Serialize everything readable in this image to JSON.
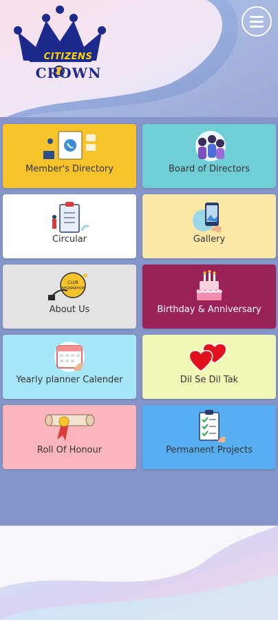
{
  "brand": {
    "line1": "CITIZENS",
    "line2": "CROWN"
  },
  "menu": {
    "icon": "hamburger-menu-icon"
  },
  "tiles": [
    {
      "label": "Member's Directory",
      "color": "#f6c32b",
      "icon": "directory-icon"
    },
    {
      "label": "Board of Directors",
      "color": "#70cfd6",
      "icon": "people-group-icon"
    },
    {
      "label": "Circular",
      "color": "#ffffff",
      "icon": "clipboard-icon"
    },
    {
      "label": "Gallery",
      "color": "#fbe7a6",
      "icon": "photo-phone-icon"
    },
    {
      "label": "About Us",
      "color": "#e3e3e3",
      "icon": "info-tag-icon"
    },
    {
      "label": "Birthday & Anniversary",
      "color": "#9b2159",
      "icon": "cake-icon"
    },
    {
      "label": "Yearly planner Calender",
      "color": "#a6e6f7",
      "icon": "calendar-icon"
    },
    {
      "label": "Dil Se Dil Tak",
      "color": "#f2f7b5",
      "icon": "hearts-icon"
    },
    {
      "label": "Roll Of Honour",
      "color": "#fbb5bd",
      "icon": "scroll-medal-icon"
    },
    {
      "label": "Permanent Projects",
      "color": "#56aef0",
      "icon": "checklist-icon"
    }
  ]
}
